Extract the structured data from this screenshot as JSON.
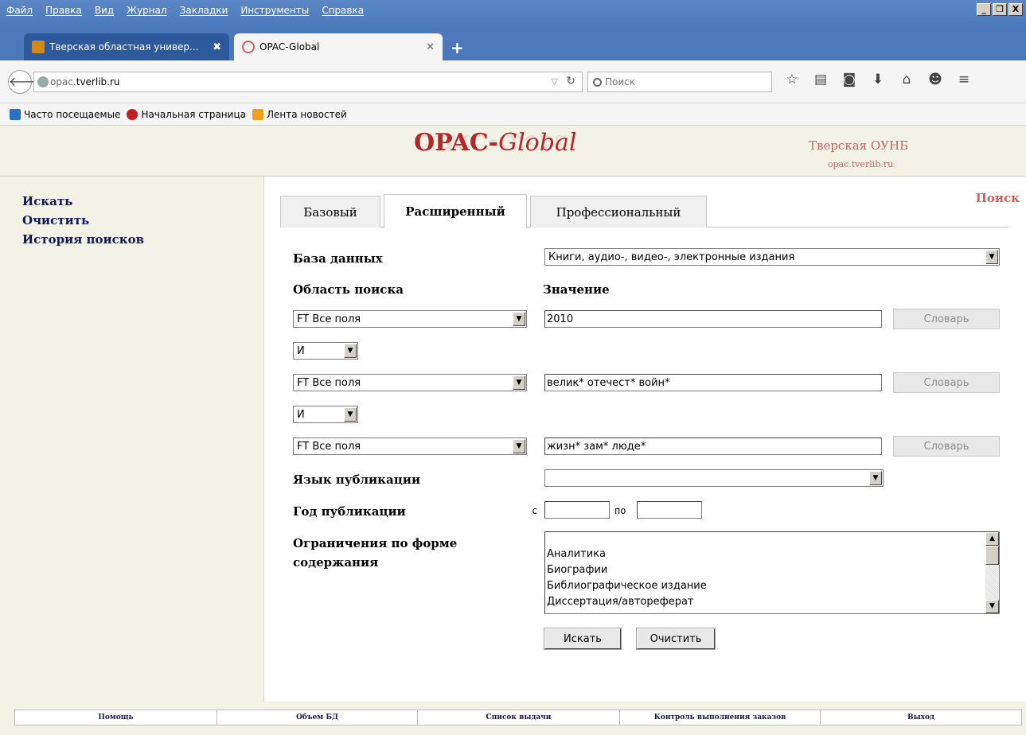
{
  "browser": {
    "menu": [
      "Файл",
      "Правка",
      "Вид",
      "Журнал",
      "Закладки",
      "Инструменты",
      "Справка"
    ],
    "window_controls": [
      "_",
      "❐",
      "X"
    ],
    "tabs": [
      {
        "title": "Тверская областная универ...",
        "active": false,
        "favicon_color": "#d08a1a"
      },
      {
        "title": "OPAC-Global",
        "active": true,
        "favicon_color": "#e05a5a"
      }
    ],
    "new_tab": "+",
    "url_prefix": "opac.",
    "url_domain": "tverlib.ru",
    "search_placeholder": "Поиск",
    "bookmarks": [
      {
        "label": "Часто посещаемые",
        "icon_color": "#2b6fc9"
      },
      {
        "label": "Начальная страница",
        "icon_color": "#c22020"
      },
      {
        "label": "Лента новостей",
        "icon_color": "#f0a020"
      }
    ],
    "toolbar_icons": [
      "star-icon",
      "reading-list-icon",
      "pocket-icon",
      "download-icon",
      "home-icon",
      "chat-icon",
      "menu-icon"
    ]
  },
  "site": {
    "logo_opac": "OPAC-",
    "logo_global": "Global",
    "org_name": "Тверская ОУНБ",
    "org_url": "opac.tverlib.ru",
    "accent_color": "#b3262a"
  },
  "sidebar": {
    "links": [
      "Искать",
      "Очистить",
      "История поисков"
    ]
  },
  "search": {
    "section_label": "Поиск",
    "tabs": [
      "Базовый",
      "Расширенный",
      "Профессиональный"
    ],
    "active_tab": "Расширенный",
    "db_label": "База данных",
    "db_value": "Книги, аудио-, видео-, электронные издания",
    "area_header": "Область поиска",
    "value_header": "Значение",
    "rows": [
      {
        "field": "FT Все поля",
        "value": "2010",
        "dict": "Словарь"
      },
      {
        "field": "FT Все поля",
        "value": "велик* отечест* войн*",
        "dict": "Словарь"
      },
      {
        "field": "FT Все поля",
        "value": "жизн* зам* люде*",
        "dict": "Словарь"
      }
    ],
    "operators": [
      "И",
      "И"
    ],
    "lang_label": "Язык публикации",
    "lang_value": "",
    "year_label": "Год публикации",
    "year_from_label": "с",
    "year_to_label": "по",
    "year_from": "",
    "year_to": "",
    "form_label_1": "Ограничения по форме",
    "form_label_2": "содержания",
    "form_options": [
      "Аналитика",
      "Биографии",
      "Библиографическое издание",
      "Диссертация/автореферат"
    ],
    "submit": "Искать",
    "clear": "Очистить"
  },
  "footer": {
    "links": [
      "Помощь",
      "Объем БД",
      "Список выдачи",
      "Контроль выполнения заказов",
      "Выход"
    ]
  }
}
